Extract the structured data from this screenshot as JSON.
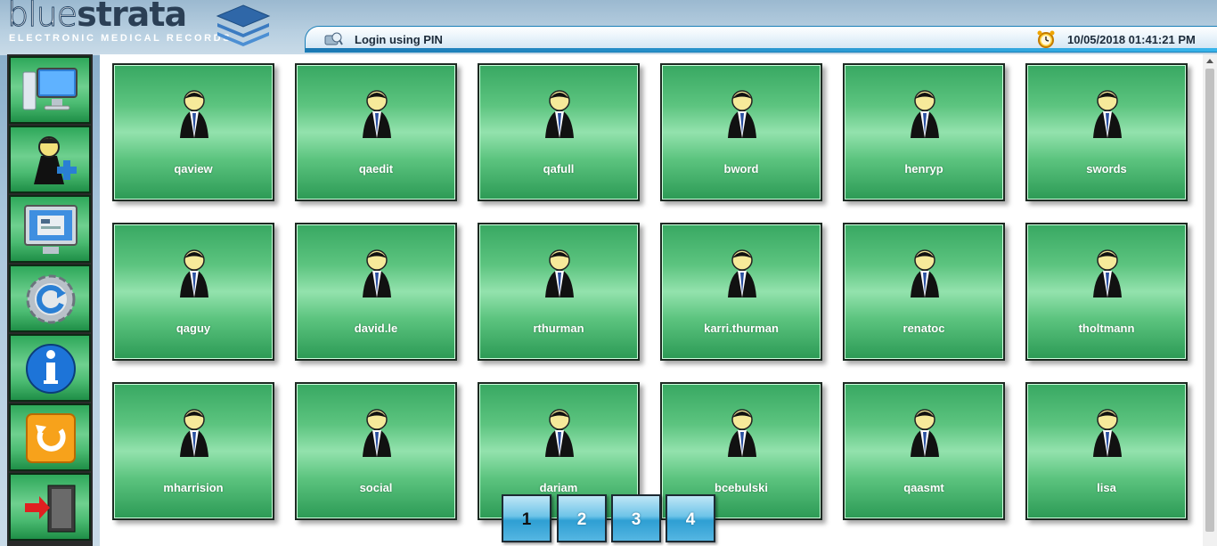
{
  "brand": {
    "name_light": "blue",
    "name_bold": "strata",
    "subtitle": "ELECTRONIC MEDICAL RECORDS"
  },
  "titlebar": {
    "title": "Login using PIN",
    "datetime": "10/05/2018 01:41:21 PM"
  },
  "sidebar": {
    "items": [
      {
        "icon": "computer-monitor-icon"
      },
      {
        "icon": "add-user-icon"
      },
      {
        "icon": "screen-form-icon"
      },
      {
        "icon": "refresh-gear-icon"
      },
      {
        "icon": "info-icon"
      },
      {
        "icon": "reload-icon"
      },
      {
        "icon": "exit-door-icon"
      }
    ]
  },
  "users": [
    "qaview",
    "qaedit",
    "qafull",
    "bword",
    "henryp",
    "swords",
    "qaguy",
    "david.le",
    "rthurman",
    "karri.thurman",
    "renatoc",
    "tholtmann",
    "mharrision",
    "social",
    "dariam",
    "bcebulski",
    "qaasmt",
    "lisa"
  ],
  "pagination": {
    "pages": [
      "1",
      "2",
      "3",
      "4"
    ],
    "current": "1"
  },
  "colors": {
    "tile_green": "#5cc47f",
    "page_blue": "#2e9fd3",
    "sidebar_green": "#4cbc73"
  }
}
